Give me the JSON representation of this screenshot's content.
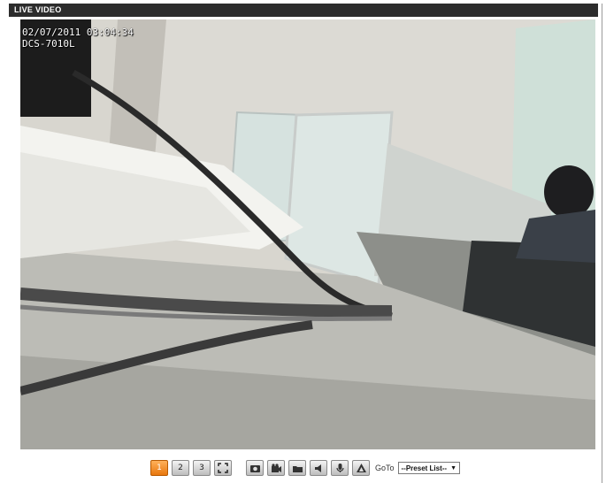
{
  "header": {
    "title": "LIVE VIDEO"
  },
  "video": {
    "osd_timestamp": "02/07/2011 03:04:34",
    "osd_camera": "DCS-7010L"
  },
  "toolbar": {
    "stream_buttons": [
      "1",
      "2",
      "3"
    ],
    "goto_label": "GoTo",
    "preset_value": "--Preset List--"
  },
  "colors": {
    "active_button": "#f08a1e",
    "header_bg": "#2c2c2c"
  }
}
